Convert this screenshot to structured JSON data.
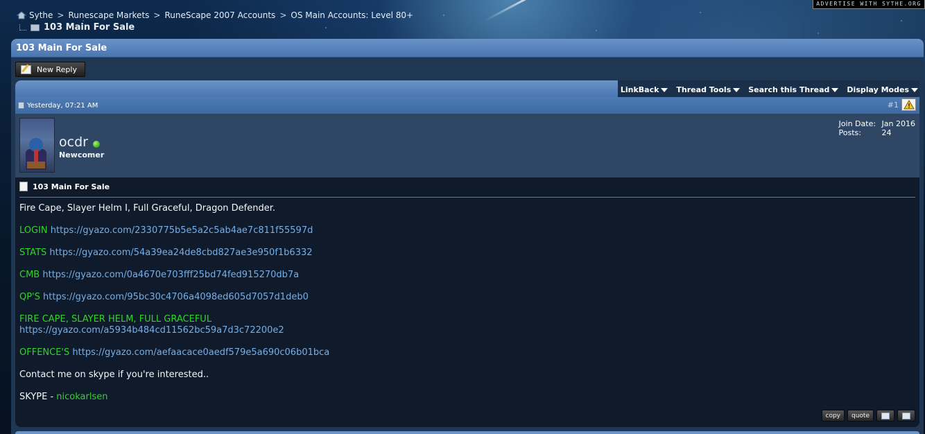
{
  "advertise": "ADVERTISE WITH SYTHE.ORG",
  "breadcrumb": {
    "items": [
      "Sythe",
      "Runescape Markets",
      "RuneScape 2007 Accounts",
      "OS Main Accounts: Level 80+"
    ],
    "separator": ">",
    "current": "103 Main For Sale"
  },
  "panel": {
    "title": "103 Main For Sale",
    "new_reply": "New Reply"
  },
  "tools_menu": [
    "LinkBack",
    "Thread Tools",
    "Search this Thread",
    "Display Modes"
  ],
  "post": {
    "date": "Yesterday, 07:21 AM",
    "number": "#1",
    "user": {
      "name": "ocdr",
      "title": "Newcomer",
      "online": true,
      "join_label": "Join Date:",
      "join_value": "Jan 2016",
      "posts_label": "Posts:",
      "posts_value": "24"
    },
    "title": "103 Main For Sale",
    "lines": {
      "intro": "Fire Cape, Slayer Helm I, Full Graceful, Dragon Defender.",
      "login_label": "LOGIN",
      "login_url": "https://gyazo.com/2330775b5e5a2c5ab4ae7c811f55597d",
      "stats_label": "STATS",
      "stats_url": "https://gyazo.com/54a39ea24de8cbd827ae3e950f1b6332",
      "cmb_label": "CMB",
      "cmb_url": "https://gyazo.com/0a4670e703fff25bd74fed915270db7a",
      "qps_label": "QP'S",
      "qps_url": "https://gyazo.com/95bc30c4706a4098ed605d7057d1deb0",
      "fire_label": "FIRE CAPE, SLAYER HELM, FULL GRACEFUL",
      "fire_url": "https://gyazo.com/a5934b484cd11562bc59a7d3c72200e2",
      "offence_label": "OFFENCE'S",
      "offence_url": "https://gyazo.com/aefaacace0aedf579e5a690c06b01bca",
      "contact": "Contact me on skype if you're interested..",
      "skype_label": "SKYPE -",
      "skype_value": "nicokarlsen"
    },
    "buttons": {
      "copy": "copy",
      "quote": "quote"
    }
  },
  "colors": {
    "accent_blue": "#4a76b0",
    "green_text": "#35d22e",
    "link_blue": "#76aee8"
  }
}
